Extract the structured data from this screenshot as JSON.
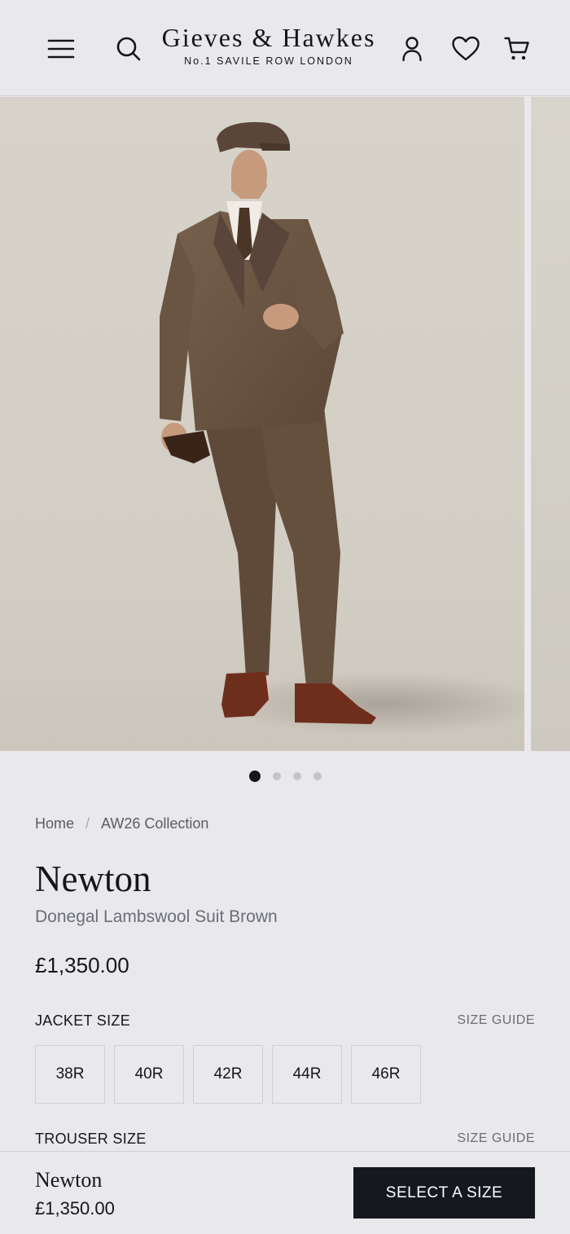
{
  "brand": {
    "name": "Gieves & Hawkes",
    "tagline": "No.1 SAVILE ROW LONDON"
  },
  "header": {
    "icons": [
      "menu-icon",
      "search-icon",
      "account-icon",
      "heart-icon",
      "cart-icon"
    ]
  },
  "gallery": {
    "slide_count": 4,
    "active_slide": 1
  },
  "breadcrumb": {
    "items": [
      "Home",
      "AW26 Collection"
    ],
    "separator": "/"
  },
  "product": {
    "name": "Newton",
    "subtitle": "Donegal Lambswool Suit Brown",
    "price": "£1,350.00"
  },
  "jacket": {
    "label": "JACKET SIZE",
    "guide": "SIZE GUIDE",
    "sizes": [
      "38R",
      "40R",
      "42R",
      "44R",
      "46R"
    ]
  },
  "trouser": {
    "label": "TROUSER SIZE",
    "guide": "SIZE GUIDE"
  },
  "sticky": {
    "name": "Newton",
    "price": "£1,350.00",
    "cta": "SELECT A SIZE"
  },
  "colors": {
    "background": "#e9e9ec",
    "text": "#15161a",
    "muted": "#6b6e78",
    "cta_bg": "#15181f"
  }
}
